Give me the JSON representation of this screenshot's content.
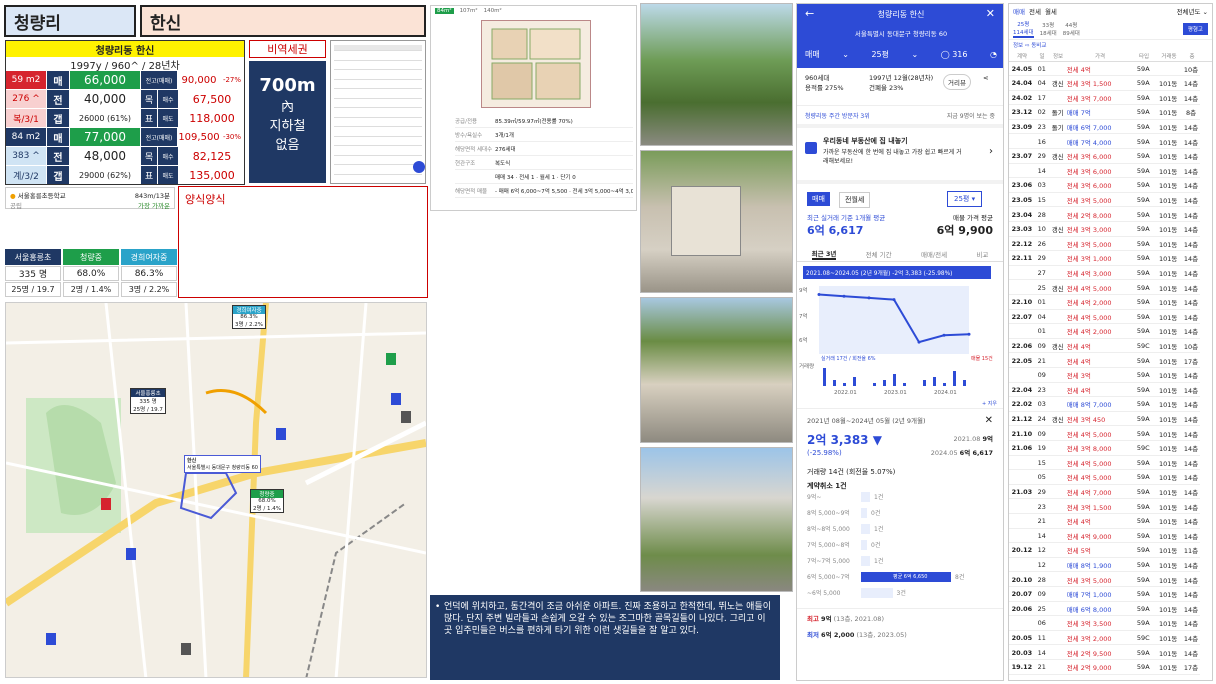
{
  "header": {
    "region": "청량리",
    "apt": "한신"
  },
  "summary": {
    "title": "청량리동 한신",
    "sub": "1997y / 960^ / 28년차",
    "row1": {
      "size": "59 m2",
      "mae": "매",
      "mae_val": "66,000",
      "jeon": "전",
      "jeon_val": "40,000",
      "gap": "갭",
      "gap_val": "26000 (61%)",
      "hi_lbl": "전고(매매)",
      "hi_val": "90,000",
      "hi_pct": "-27%",
      "mok": "목",
      "mok_mae": "매수",
      "mok_val": "67,500",
      "pyo": "표",
      "pyo_mae": "매도",
      "pyo_val": "118,000",
      "side1": "276 ^",
      "side2": "복/3/1"
    },
    "row2": {
      "size": "84 m2",
      "mae": "매",
      "mae_val": "77,000",
      "jeon": "전",
      "jeon_val": "48,000",
      "gap": "갭",
      "gap_val": "29000 (62%)",
      "hi_lbl": "전고(매매)",
      "hi_val": "109,500",
      "hi_pct": "-30%",
      "mok": "목",
      "mok_mae": "매수",
      "mok_val": "82,125",
      "pyo": "표",
      "pyo_mae": "매도",
      "pyo_val": "135,000",
      "side1": "383 ^",
      "side2": "계/3/2"
    }
  },
  "station": {
    "label": "비역세권",
    "big": "700m",
    "line2": "內",
    "line3": "지하철",
    "line4": "없음"
  },
  "school_row": {
    "name": "서울홍릉초등학교",
    "dist": "843m/13분",
    "type": "공립",
    "link": "가장 가까운"
  },
  "style": {
    "label": "양식양식"
  },
  "schools": [
    {
      "name": "서울홍릉초",
      "v1": "335 명",
      "v2": "25명 / 19.7",
      "color": "#1f3864"
    },
    {
      "name": "청량중",
      "v1": "68.0%",
      "v2": "2명 / 1.4%",
      "color": "#1e9e4a"
    },
    {
      "name": "경희여자중",
      "v1": "86.3%",
      "v2": "3명 / 2.2%",
      "color": "#2aa3c9"
    }
  ],
  "map": {
    "tag1": {
      "name": "경희여자중",
      "l1": "86.3%",
      "l2": "3명 / 2.2%"
    },
    "tag2": {
      "name": "서울홍릉초",
      "l1": "335 명",
      "l2": "25명 / 19.7"
    },
    "tag3": {
      "name": "청량중",
      "l1": "68.0%",
      "l2": "2명 / 1.4%"
    },
    "apt_label": "한신",
    "apt_addr": "서울특별시 동대문구 청량리동 60"
  },
  "floorplan": {
    "tabs": [
      "84m²",
      "107m²",
      "140m²"
    ],
    "info": [
      {
        "k": "공급/전용",
        "v": "85.39㎡/59.97㎡(전용률 70%)"
      },
      {
        "k": "방수/욕실수",
        "v": "3개/1개"
      },
      {
        "k": "해당면적 세대수",
        "v": "276세대"
      },
      {
        "k": "현관구조",
        "v": "복도식"
      },
      {
        "k": "",
        "v": "매매 34 · 전세 1 · 월세 1 · 단기 0"
      },
      {
        "k": "해당면적 매물",
        "v": "- 매매 6억 6,000~7억 5,500 · 전세 3억 5,000~4억 3,000"
      }
    ]
  },
  "desc": "언덕에 위치하고, 동간격이 조금 아쉬운 아파트. 진짜 조용하고 한적한데, 뛰노는 애들이 많다. 단지 주변 빌라들과 손쉽게 오갈 수 있는 조그마한 골목길들이 나있다. 그리고 이곳 입주민들은 버스를 편하게 타기 위한 이런 샛길들을 잘 알고 있다.",
  "app": {
    "title": "청량리동 한신",
    "addr": "서울특별시 동대문구 청량리동 60",
    "tab_mae": "매매",
    "tab_size": "25평",
    "comments": "316",
    "i1": "960세대",
    "i2": "용적률 275%",
    "i3": "1997년 12월(28년차)",
    "i4": "건폐율 23%",
    "dist_btn": "거리뷰",
    "visitors": "청량리동 주간 방문자 3위",
    "visitors_r": "지금 9명이 보는 중",
    "promo_title": "우리동네 부동산에 집 내놓기",
    "promo_sub": "가까운 부동산에 한 번에 집 내놓고 가장 쉽고 빠르게 거래해보세요!",
    "btn_mae": "매매",
    "btn_jeon": "전월세",
    "size_sel": "25평",
    "recent_lbl": "최근 실거래 기준 1개월 평균",
    "recent_val": "6억 6,617",
    "ask_lbl": "매물 가격 평균",
    "ask_val": "6억 9,900",
    "tabs": [
      "최근 3년",
      "전체 기간",
      "매매/전세",
      "비교"
    ],
    "range": "2021.08~2024.05 (2년 9개월)  -2억 3,383 (-25.98%)",
    "y_labels": [
      "9억",
      "7억",
      "6억",
      "거래량"
    ],
    "x_labels": [
      "2022.01",
      "2023.01",
      "2024.01"
    ],
    "vol_lbl": "실거래 17건 / 회전율 6%",
    "vol_r": "매물 15건",
    "period": "2021년 08월~2024년 05월 (2년 9개월)",
    "change": "2억 3,383 ▼",
    "change_pct": "(-25.98%)",
    "from_lbl": "2021.08",
    "from_val": "9억",
    "to_lbl": "2024.05",
    "to_val": "6억 6,617",
    "turnover": "거래량 14건 (회전율 5.07%)",
    "cancel": "계약취소 1건",
    "dist": [
      {
        "k": "9억~",
        "v": "1건",
        "w": 10
      },
      {
        "k": "8억 5,000~9억",
        "v": "0건",
        "w": 0
      },
      {
        "k": "8억~8억 5,000",
        "v": "1건",
        "w": 10
      },
      {
        "k": "7억 5,000~8억",
        "v": "0건",
        "w": 0
      },
      {
        "k": "7억~7억 5,000",
        "v": "1건",
        "w": 10
      },
      {
        "k": "6억 5,000~7억",
        "v": "8건",
        "w": 100
      },
      {
        "k": "~6억 5,000",
        "v": "3건",
        "w": 35
      }
    ],
    "avg_tag": "평균 6억 6,650",
    "max_lbl": "최고",
    "max_val": "9억",
    "max_sub": "(13층, 2021.08)",
    "min_lbl": "최저",
    "min_val": "6억 2,000",
    "min_sub": "(13층, 2023.05)"
  },
  "chart_data": {
    "type": "line",
    "title": "",
    "x": [
      "2021.08",
      "2022.01",
      "2022.06",
      "2023.01",
      "2023.06",
      "2024.01",
      "2024.05"
    ],
    "series": [
      {
        "values": [
          9.0,
          8.9,
          8.8,
          8.7,
          6.2,
          6.6,
          6.66
        ]
      }
    ],
    "ylim": [
      5.5,
      9.5
    ]
  },
  "deals": {
    "tabs": [
      "매매",
      "전세",
      "월세"
    ],
    "filter": "전체년도",
    "sizes": [
      "25평",
      "33평",
      "44평"
    ],
    "subs": [
      "114세대",
      "18세대",
      "89세대"
    ],
    "btn": "평형고",
    "head": [
      "계약",
      "일",
      "정보",
      "가격",
      "타입",
      "거래동",
      "층"
    ],
    "rows": [
      [
        "24.05",
        "01",
        "",
        "전세 4억",
        "59A",
        "",
        "10층"
      ],
      [
        "24.04",
        "04",
        "갱신",
        "전세 3억 1,500",
        "59A",
        "101동",
        "14층"
      ],
      [
        "24.02",
        "17",
        "",
        "전세 3억 7,000",
        "59A",
        "101동",
        "14층"
      ],
      [
        "23.12",
        "02",
        "돌기",
        "매매 7억",
        "59A",
        "101동",
        "8층"
      ],
      [
        "23.09",
        "23",
        "돌기",
        "매매 6억 7,000",
        "59A",
        "101동",
        "14층"
      ],
      [
        "",
        "16",
        "",
        "매매 7억 4,000",
        "59A",
        "101동",
        "14층"
      ],
      [
        "23.07",
        "29",
        "갱신",
        "전세 3억 6,000",
        "59A",
        "101동",
        "14층"
      ],
      [
        "",
        "14",
        "",
        "전세 3억 6,000",
        "59A",
        "101동",
        "14층"
      ],
      [
        "23.06",
        "03",
        "",
        "전세 3억 6,000",
        "59A",
        "101동",
        "14층"
      ],
      [
        "23.05",
        "15",
        "",
        "전세 3억 5,000",
        "59A",
        "101동",
        "14층"
      ],
      [
        "23.04",
        "28",
        "",
        "전세 2억 8,000",
        "59A",
        "101동",
        "14층"
      ],
      [
        "23.03",
        "10",
        "갱신",
        "전세 3억 3,000",
        "59A",
        "101동",
        "14층"
      ],
      [
        "22.12",
        "26",
        "",
        "전세 3억 5,000",
        "59A",
        "101동",
        "14층"
      ],
      [
        "22.11",
        "29",
        "",
        "전세 3억 1,000",
        "59A",
        "101동",
        "14층"
      ],
      [
        "",
        "27",
        "",
        "전세 4억 3,000",
        "59A",
        "101동",
        "14층"
      ],
      [
        "",
        "25",
        "갱신",
        "전세 4억 5,000",
        "59A",
        "101동",
        "14층"
      ],
      [
        "22.10",
        "01",
        "",
        "전세 4억 2,000",
        "59A",
        "101동",
        "14층"
      ],
      [
        "22.07",
        "04",
        "",
        "전세 4억 5,000",
        "59A",
        "101동",
        "14층"
      ],
      [
        "",
        "01",
        "",
        "전세 4억 2,000",
        "59A",
        "101동",
        "14층"
      ],
      [
        "22.06",
        "09",
        "갱신",
        "전세 4억",
        "59C",
        "101동",
        "10층"
      ],
      [
        "22.05",
        "21",
        "",
        "전세 4억",
        "59A",
        "101동",
        "17층"
      ],
      [
        "",
        "09",
        "",
        "전세 3억",
        "59A",
        "101동",
        "14층"
      ],
      [
        "22.04",
        "23",
        "",
        "전세 4억",
        "59A",
        "101동",
        "14층"
      ],
      [
        "22.02",
        "03",
        "",
        "매매 8억 7,000",
        "59A",
        "101동",
        "14층"
      ],
      [
        "21.12",
        "24",
        "갱신",
        "전세 3억 450",
        "59A",
        "101동",
        "14층"
      ],
      [
        "21.10",
        "09",
        "",
        "전세 4억 5,000",
        "59A",
        "101동",
        "14층"
      ],
      [
        "21.06",
        "19",
        "",
        "전세 3억 8,000",
        "59C",
        "101동",
        "14층"
      ],
      [
        "",
        "15",
        "",
        "전세 4억 5,000",
        "59A",
        "101동",
        "14층"
      ],
      [
        "",
        "05",
        "",
        "전세 4억 5,000",
        "59A",
        "101동",
        "14층"
      ],
      [
        "21.03",
        "29",
        "",
        "전세 4억 7,000",
        "59A",
        "101동",
        "14층"
      ],
      [
        "",
        "23",
        "",
        "전세 3억 1,500",
        "59A",
        "101동",
        "14층"
      ],
      [
        "",
        "21",
        "",
        "전세 4억",
        "59A",
        "101동",
        "14층"
      ],
      [
        "",
        "14",
        "",
        "전세 4억 9,000",
        "59A",
        "101동",
        "14층"
      ],
      [
        "20.12",
        "12",
        "",
        "전세 5억",
        "59A",
        "101동",
        "11층"
      ],
      [
        "",
        "12",
        "",
        "매매 8억 1,900",
        "59A",
        "101동",
        "14층"
      ],
      [
        "20.10",
        "28",
        "",
        "전세 3억 5,000",
        "59A",
        "101동",
        "14층"
      ],
      [
        "20.07",
        "09",
        "",
        "매매 7억 1,000",
        "59A",
        "101동",
        "14층"
      ],
      [
        "20.06",
        "25",
        "",
        "매매 6억 8,000",
        "59A",
        "101동",
        "14층"
      ],
      [
        "",
        "06",
        "",
        "전세 3억 3,500",
        "59A",
        "101동",
        "14층"
      ],
      [
        "20.05",
        "11",
        "",
        "전세 3억 2,000",
        "59C",
        "101동",
        "14층"
      ],
      [
        "20.03",
        "14",
        "",
        "전세 2억 9,500",
        "59A",
        "101동",
        "14층"
      ],
      [
        "19.12",
        "21",
        "",
        "전세 2억 9,000",
        "59A",
        "101동",
        "17층"
      ]
    ]
  }
}
